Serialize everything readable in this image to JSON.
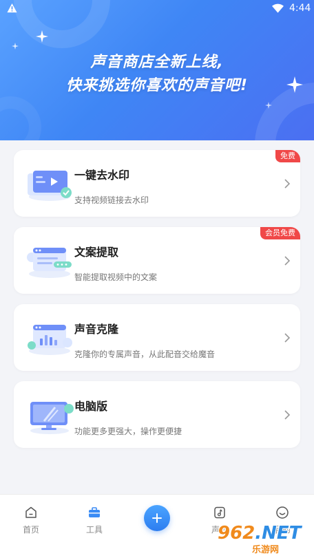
{
  "status_bar": {
    "time": "4:44",
    "icons": [
      "warning-icon",
      "wifi-icon",
      "battery-icon"
    ]
  },
  "hero": {
    "line1": "声音商店全新上线,",
    "line2": "快来挑选你喜欢的声音吧!",
    "gradient_start": "#5aa2ff",
    "gradient_end": "#4b6ff2"
  },
  "cards": [
    {
      "title": "一键去水印",
      "desc": "支持视频链接去水印",
      "badge": "免费",
      "icon": "video-watermark-icon"
    },
    {
      "title": "文案提取",
      "desc": "智能提取视频中的文案",
      "badge": "会员免费",
      "icon": "text-extract-icon"
    },
    {
      "title": "声音克隆",
      "desc": "克隆你的专属声音，从此配音交给魔音",
      "badge": "",
      "icon": "voice-clone-icon"
    },
    {
      "title": "电脑版",
      "desc": "功能更多更强大，操作更便捷",
      "badge": "",
      "icon": "desktop-icon"
    }
  ],
  "bottom_nav": {
    "items": [
      {
        "label": "首页",
        "icon": "home-icon"
      },
      {
        "label": "工具",
        "icon": "toolbox-icon",
        "active": true
      },
      {
        "label": "",
        "icon": "plus-icon"
      },
      {
        "label": "声音",
        "icon": "music-note-icon"
      },
      {
        "label": "我的",
        "icon": "smile-icon"
      }
    ]
  },
  "watermark": {
    "logo": "962",
    "logo_suffix": ".NET",
    "sub": "乐游网"
  },
  "colors": {
    "accent": "#3f86f5",
    "badge": "#f04848",
    "tool_active": "#3b8cf5"
  }
}
